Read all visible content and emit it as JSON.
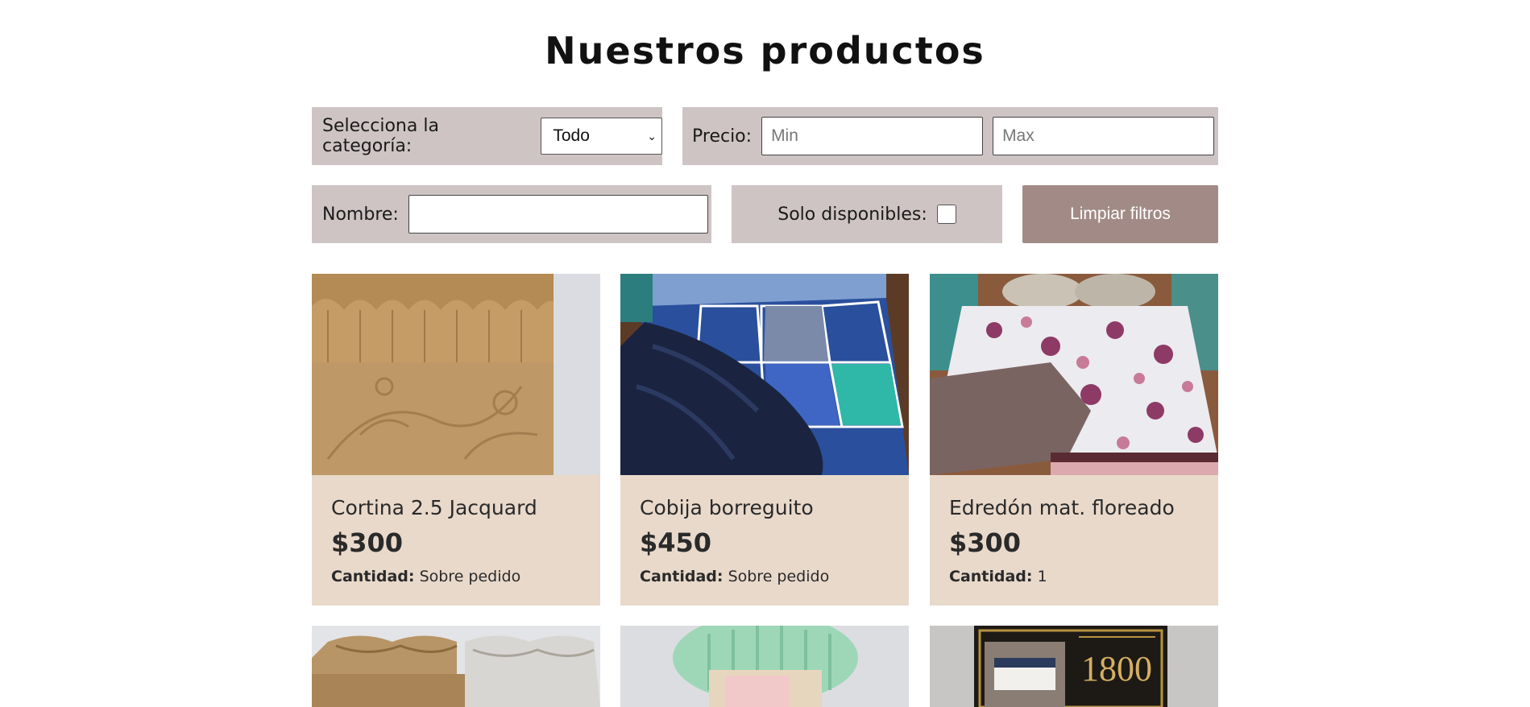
{
  "page": {
    "title": "Nuestros productos"
  },
  "filters": {
    "category_label": "Selecciona la categoría:",
    "category_value": "Todo",
    "price_label": "Precio:",
    "min_placeholder": "Min",
    "max_placeholder": "Max",
    "name_label": "Nombre:",
    "name_value": "",
    "available_label": "Solo disponibles:",
    "available_checked": false,
    "clear_label": "Limpiar filtros"
  },
  "products": [
    {
      "name": "Cortina 2.5 Jacquard",
      "price": "$300",
      "qty_label": "Cantidad:",
      "qty_value": "Sobre pedido",
      "image": "gold-jacquard-curtain"
    },
    {
      "name": "Cobija borreguito",
      "price": "$450",
      "qty_label": "Cantidad:",
      "qty_value": "Sobre pedido",
      "image": "blue-patchwork-blanket"
    },
    {
      "name": "Edredón mat. floreado",
      "price": "$300",
      "qty_label": "Cantidad:",
      "qty_value": "1",
      "image": "floral-comforter"
    },
    {
      "image": "curtain-bundle"
    },
    {
      "image": "mint-blanket-roll"
    },
    {
      "image": "sheet-set-box",
      "image_text": "1800"
    }
  ],
  "colors": {
    "filter_bg": "#cec4c4",
    "button_bg": "#a28b86",
    "card_bg": "#e9d9cb"
  }
}
